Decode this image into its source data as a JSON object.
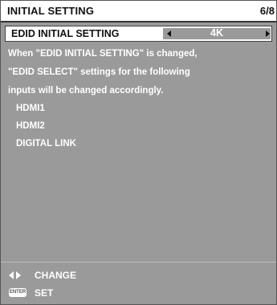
{
  "header": {
    "title": "INITIAL SETTING",
    "page": "6/8"
  },
  "setting": {
    "label": "EDID INITIAL SETTING",
    "value": "4K"
  },
  "message": {
    "lines": [
      "When \"EDID INITIAL SETTING\" is changed,",
      "\"EDID SELECT\" settings for the following",
      "inputs will be changed accordingly."
    ],
    "inputs": [
      "HDMI1",
      "HDMI2",
      "DIGITAL LINK"
    ]
  },
  "guide": {
    "change_label": "CHANGE",
    "change_icon": "left-right-arrows-icon",
    "set_label": "SET",
    "set_icon": "enter-button-icon",
    "enter_badge": "ENTER"
  },
  "colors": {
    "background": "#9a9a9a",
    "panel": "#ffffff",
    "text_on_gray": "#ffffff",
    "text_on_white": "#111111"
  }
}
